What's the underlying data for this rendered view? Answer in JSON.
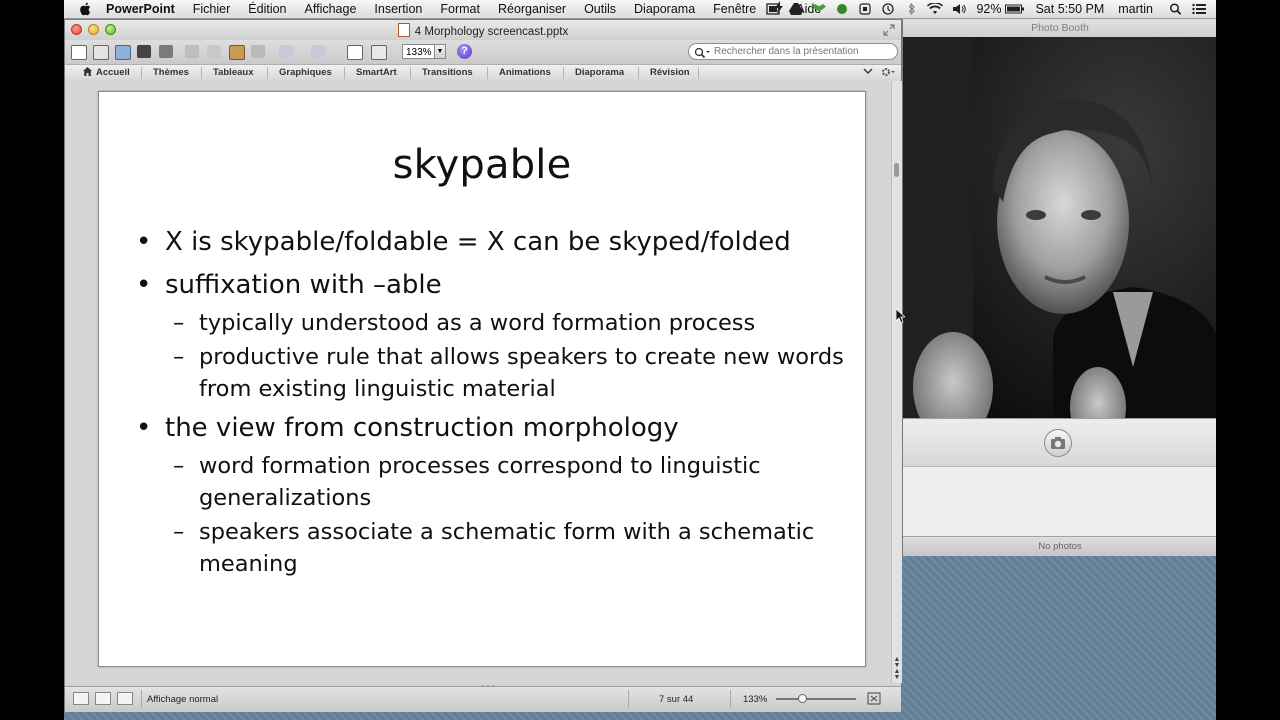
{
  "menubar": {
    "app": "PowerPoint",
    "items": [
      "Fichier",
      "Édition",
      "Affichage",
      "Insertion",
      "Format",
      "Réorganiser",
      "Outils",
      "Diaporama",
      "Fenêtre",
      "Aide"
    ],
    "battery": "92%",
    "clock": "Sat 5:50 PM",
    "user": "martin"
  },
  "ppt": {
    "window_title": "4 Morphology screencast.pptx",
    "zoom": "133%",
    "search_placeholder": "Rechercher dans la présentation",
    "ribbon_tabs": [
      "Accueil",
      "Thèmes",
      "Tableaux",
      "Graphiques",
      "SmartArt",
      "Transitions",
      "Animations",
      "Diaporama",
      "Révision"
    ],
    "slide": {
      "title": "skypable",
      "bullets": [
        {
          "level": 1,
          "text": "X is skypable/foldable = X can be skyped/folded"
        },
        {
          "level": 1,
          "text": "suffixation with –able"
        },
        {
          "level": 2,
          "text": "typically understood as a word formation process"
        },
        {
          "level": 2,
          "text": "productive rule that allows speakers to create new words from existing linguistic material"
        },
        {
          "level": 1,
          "text": "the view from construction morphology"
        },
        {
          "level": 2,
          "text": "word formation processes correspond to linguistic generalizations"
        },
        {
          "level": 2,
          "text": "speakers associate a schematic form with a schematic meaning"
        }
      ]
    },
    "status": {
      "view": "Affichage normal",
      "slide_position": "7 sur 44",
      "zoom": "133%"
    }
  },
  "photobooth": {
    "title": "Photo Booth",
    "status": "No photos"
  }
}
